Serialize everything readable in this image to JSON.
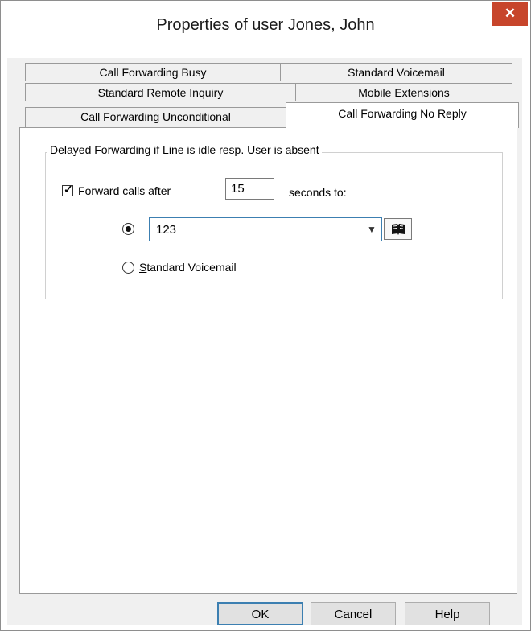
{
  "window": {
    "title": "Properties of user Jones, John",
    "close_glyph": "✕"
  },
  "tabs": {
    "row1": [
      "Call Forwarding Busy",
      "Standard Voicemail"
    ],
    "row2": [
      "Standard Remote Inquiry",
      "Mobile Extensions"
    ],
    "row3": [
      "Call Forwarding Unconditional",
      "Call Forwarding No Reply"
    ],
    "active": "Call Forwarding No Reply"
  },
  "group": {
    "legend": "Delayed Forwarding if Line is idle resp. User is absent",
    "forward_checkbox": {
      "checked": true,
      "label_accel": "F",
      "label_rest": "orward calls after"
    },
    "seconds_value": "15",
    "seconds_suffix": "seconds to:",
    "destination_number": "123",
    "destination_selected": true,
    "voicemail_option": {
      "selected": false,
      "label_accel": "S",
      "label_rest": "tandard Voicemail"
    }
  },
  "icons": {
    "close": "close-icon",
    "checkmark": "checkmark-icon",
    "dropdown": "chevron-down-icon",
    "phonebook": "book-icon"
  },
  "buttons": {
    "ok": "OK",
    "cancel": "Cancel",
    "help": "Help"
  },
  "colors": {
    "close_button": "#c7452b",
    "focus_border": "#3c7fb1",
    "dialog_bg": "#f0f0f0"
  }
}
